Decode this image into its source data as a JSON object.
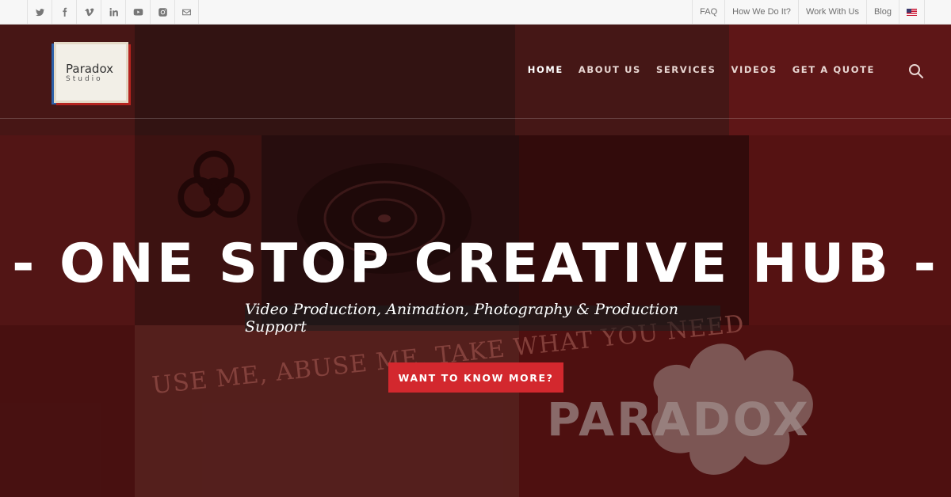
{
  "social": {
    "icons": [
      "twitter-icon",
      "facebook-icon",
      "vimeo-icon",
      "linkedin-icon",
      "youtube-icon",
      "instagram-icon",
      "email-icon"
    ]
  },
  "utility_nav": {
    "faq": "FAQ",
    "how": "How We Do It?",
    "work": "Work With Us",
    "blog": "Blog",
    "language_icon": "us-flag-icon"
  },
  "logo": {
    "main": "Paradox",
    "sub": "Studio"
  },
  "nav": {
    "items": [
      "HOME",
      "ABOUT US",
      "SERVICES",
      "VIDEOS",
      "GET A QUOTE"
    ],
    "active": "HOME",
    "search_icon": "search-icon"
  },
  "hero": {
    "headline": "- ONE STOP CREATIVE HUB -",
    "subline": "Video Production, Animation, Photography & Production Support",
    "cta": "WANT TO KNOW MORE?",
    "background_texts": [
      "USE ME, ABUSE ME, TAKE WHAT YOU NEED",
      "PARADOX"
    ]
  },
  "colors": {
    "accent": "#d3282e",
    "topbar": "#f7f7f7",
    "hero_tint": "#5a1a18"
  }
}
